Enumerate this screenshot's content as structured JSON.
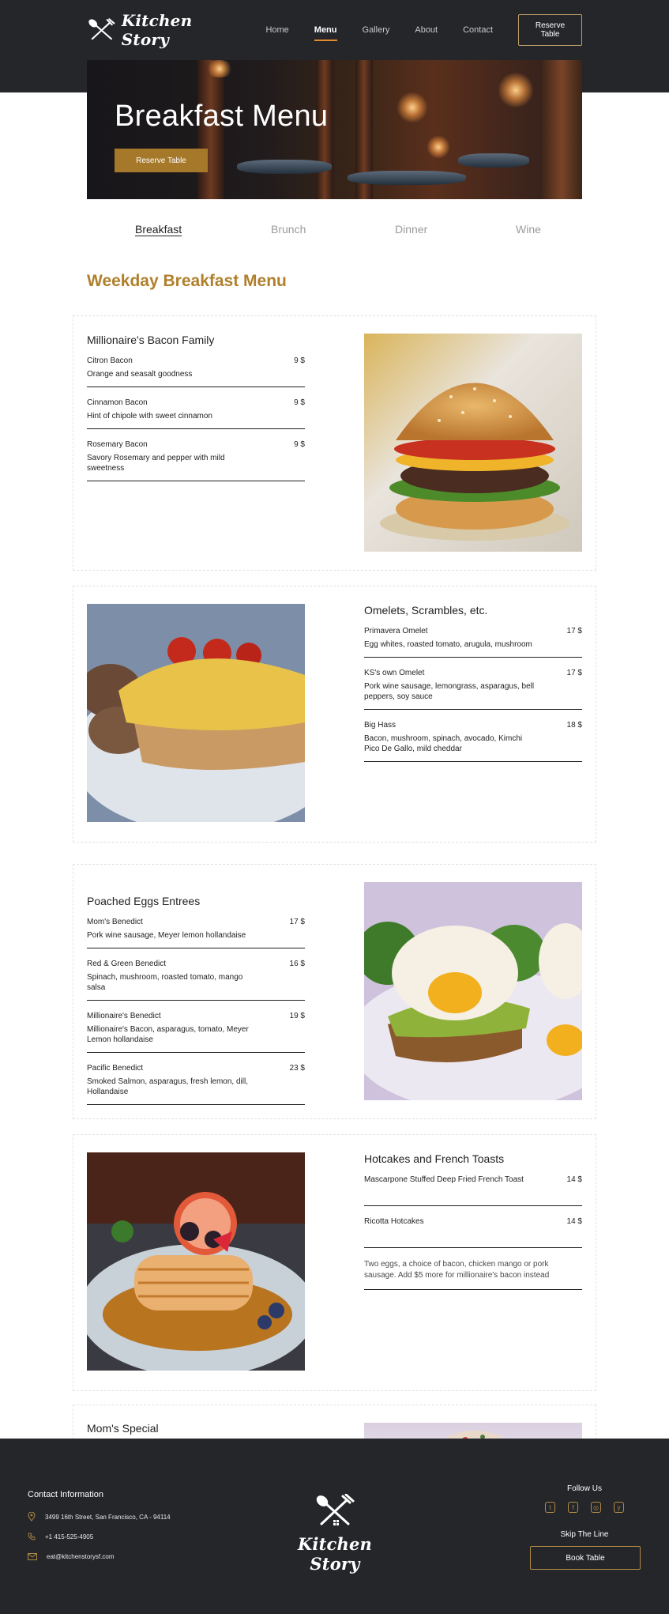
{
  "brand": {
    "name": "Kitchen Story"
  },
  "nav": {
    "items": [
      {
        "label": "Home"
      },
      {
        "label": "Menu"
      },
      {
        "label": "Gallery"
      },
      {
        "label": "About"
      },
      {
        "label": "Contact"
      }
    ],
    "active": "Menu",
    "reserve_label": "Reserve Table"
  },
  "hero": {
    "title": "Breakfast Menu",
    "button_label": "Reserve Table"
  },
  "tabs": [
    {
      "label": "Breakfast"
    },
    {
      "label": "Brunch"
    },
    {
      "label": "Dinner"
    },
    {
      "label": "Wine"
    }
  ],
  "active_tab": "Breakfast",
  "section_title": "Weekday Breakfast Menu",
  "categories": [
    {
      "title": "Millionaire's Bacon Family",
      "photo": "burger-photo",
      "items": [
        {
          "name": "Citron Bacon",
          "price": "9 $",
          "desc": "Orange and seasalt goodness"
        },
        {
          "name": "Cinnamon Bacon",
          "price": "9 $",
          "desc": "Hint of chipole with sweet cinnamon"
        },
        {
          "name": "Rosemary Bacon",
          "price": "9 $",
          "desc": "Savory Rosemary and pepper with mild sweetness"
        }
      ]
    },
    {
      "title": "Omelets, Scrambles, etc.",
      "photo": "scrambled-eggs-toast-photo",
      "items": [
        {
          "name": "Primavera Omelet",
          "price": "17 $",
          "desc": "Egg whites, roasted tomato, arugula, mushroom"
        },
        {
          "name": "KS's own Omelet",
          "price": "17 $",
          "desc": "Pork wine sausage, lemongrass, asparagus, bell peppers, soy sauce"
        },
        {
          "name": "Big Hass",
          "price": "18 $",
          "desc": "Bacon, mushroom, spinach, avocado, Kimchi Pico De Gallo, mild cheddar"
        }
      ]
    },
    {
      "title": "Poached Eggs Entrees",
      "photo": "poached-egg-avocado-photo",
      "items": [
        {
          "name": "Mom's Benedict",
          "price": "17 $",
          "desc": "Pork wine sausage, Meyer lemon hollandaise"
        },
        {
          "name": "Red & Green Benedict",
          "price": "16 $",
          "desc": "Spinach, mushroom, roasted tomato, mango salsa"
        },
        {
          "name": "Millionaire's Benedict",
          "price": "19 $",
          "desc": "Millionaire's Bacon, asparagus, tomato, Meyer Lemon hollandaise"
        },
        {
          "name": "Pacific Benedict",
          "price": "23 $",
          "desc": "Smoked Salmon, asparagus, fresh lemon, dill, Hollandaise"
        }
      ]
    },
    {
      "title": "Hotcakes and French Toasts",
      "photo": "pancakes-berries-photo",
      "items": [
        {
          "name": "Mascarpone Stuffed Deep Fried French Toast",
          "price": "14 $",
          "desc": ""
        },
        {
          "name": "Ricotta Hotcakes",
          "price": "14 $",
          "desc": ""
        }
      ],
      "note": "Two eggs, a choice of bacon, chicken mango or pork sausage. Add $5 more for millionaire's bacon instead"
    },
    {
      "title": "Mom's Special",
      "photo": "plate-photo",
      "items": []
    }
  ],
  "footer": {
    "contact_title": "Contact Information",
    "address": "3499 16th Street, San Francisco, CA - 94114",
    "phone": "+1 415-525-4905",
    "email": "eat@kitchenstorysf.com",
    "follow_label": "Follow Us",
    "socials": [
      "twitter-icon",
      "facebook-icon",
      "instagram-icon",
      "yelp-icon"
    ],
    "skip_label": "Skip The Line",
    "book_label": "Book Table"
  },
  "colors": {
    "dark": "#24262a",
    "gold": "#a5782a",
    "accent": "#e58a2e",
    "title_gold": "#b07f2c"
  }
}
